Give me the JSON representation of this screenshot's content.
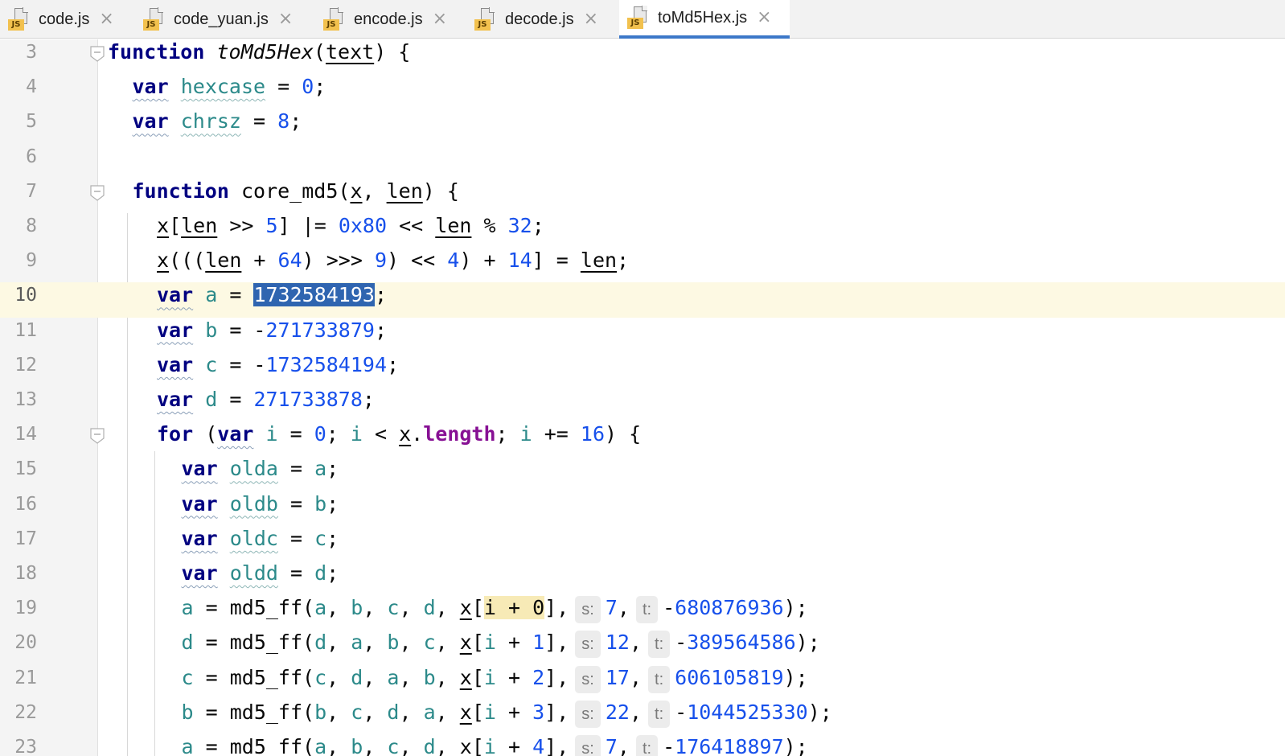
{
  "tabs": [
    {
      "label": "code.js",
      "active": false,
      "icon": "js-file-icon"
    },
    {
      "label": "code_yuan.js",
      "active": false,
      "icon": "js-file-icon"
    },
    {
      "label": "encode.js",
      "active": false,
      "icon": "js-file-icon"
    },
    {
      "label": "decode.js",
      "active": false,
      "icon": "js-file-icon"
    },
    {
      "label": "toMd5Hex.js",
      "active": true,
      "icon": "js-file-icon"
    }
  ],
  "js_badge": "JS",
  "close_glyph": "×",
  "editor": {
    "current_line": "10",
    "lines": [
      {
        "n": "3",
        "tokens": [
          [
            "kw",
            "function"
          ],
          [
            "t",
            " "
          ],
          [
            "fi",
            "toMd5Hex"
          ],
          [
            "t",
            "("
          ],
          [
            "p",
            "text"
          ],
          [
            "t",
            ") {"
          ]
        ]
      },
      {
        "n": "4",
        "tokens": [
          [
            "kww",
            "var"
          ],
          [
            "t",
            " "
          ],
          [
            "vw",
            "hexcase"
          ],
          [
            "t",
            " = "
          ],
          [
            "num",
            "0"
          ],
          [
            "t",
            ";"
          ]
        ]
      },
      {
        "n": "5",
        "tokens": [
          [
            "kww",
            "var"
          ],
          [
            "t",
            " "
          ],
          [
            "vw",
            "chrsz"
          ],
          [
            "t",
            " = "
          ],
          [
            "num",
            "8"
          ],
          [
            "t",
            ";"
          ]
        ]
      },
      {
        "n": "6",
        "tokens": []
      },
      {
        "n": "7",
        "tokens": [
          [
            "kw",
            "function"
          ],
          [
            "t",
            " core_md5("
          ],
          [
            "p",
            "x"
          ],
          [
            "t",
            ", "
          ],
          [
            "p",
            "len"
          ],
          [
            "t",
            ") {"
          ]
        ]
      },
      {
        "n": "8",
        "tokens": [
          [
            "p",
            "x"
          ],
          [
            "t",
            "["
          ],
          [
            "p",
            "len"
          ],
          [
            "t",
            " >> "
          ],
          [
            "num",
            "5"
          ],
          [
            "t",
            "] |= "
          ],
          [
            "num",
            "0x80"
          ],
          [
            "t",
            " << "
          ],
          [
            "p",
            "len"
          ],
          [
            "t",
            " % "
          ],
          [
            "num",
            "32"
          ],
          [
            "t",
            ";"
          ]
        ]
      },
      {
        "n": "9",
        "tokens": [
          [
            "p",
            "x"
          ],
          [
            "t",
            "((("
          ],
          [
            "p",
            "len"
          ],
          [
            "t",
            " + "
          ],
          [
            "num",
            "64"
          ],
          [
            "t",
            ") >>> "
          ],
          [
            "num",
            "9"
          ],
          [
            "t",
            ") << "
          ],
          [
            "num",
            "4"
          ],
          [
            "t",
            ") + "
          ],
          [
            "num",
            "14"
          ],
          [
            "t",
            "] = "
          ],
          [
            "p",
            "len"
          ],
          [
            "t",
            ";"
          ]
        ]
      },
      {
        "n": "10",
        "tokens": [
          [
            "kww",
            "var"
          ],
          [
            "t",
            " "
          ],
          [
            "v",
            "a"
          ],
          [
            "t",
            " = "
          ],
          [
            "sel",
            "1732584193"
          ],
          [
            "t",
            ";"
          ]
        ]
      },
      {
        "n": "11",
        "tokens": [
          [
            "kww",
            "var"
          ],
          [
            "t",
            " "
          ],
          [
            "v",
            "b"
          ],
          [
            "t",
            " = -"
          ],
          [
            "num",
            "271733879"
          ],
          [
            "t",
            ";"
          ]
        ]
      },
      {
        "n": "12",
        "tokens": [
          [
            "kww",
            "var"
          ],
          [
            "t",
            " "
          ],
          [
            "v",
            "c"
          ],
          [
            "t",
            " = -"
          ],
          [
            "num",
            "1732584194"
          ],
          [
            "t",
            ";"
          ]
        ]
      },
      {
        "n": "13",
        "tokens": [
          [
            "kww",
            "var"
          ],
          [
            "t",
            " "
          ],
          [
            "v",
            "d"
          ],
          [
            "t",
            " = "
          ],
          [
            "num",
            "271733878"
          ],
          [
            "t",
            ";"
          ]
        ]
      },
      {
        "n": "14",
        "tokens": [
          [
            "kw",
            "for"
          ],
          [
            "t",
            " ("
          ],
          [
            "kww",
            "var"
          ],
          [
            "t",
            " "
          ],
          [
            "v",
            "i"
          ],
          [
            "t",
            " = "
          ],
          [
            "num",
            "0"
          ],
          [
            "t",
            "; "
          ],
          [
            "v",
            "i"
          ],
          [
            "t",
            " < "
          ],
          [
            "p",
            "x"
          ],
          [
            "t",
            "."
          ],
          [
            "prop",
            "length"
          ],
          [
            "t",
            "; "
          ],
          [
            "v",
            "i"
          ],
          [
            "t",
            " += "
          ],
          [
            "num",
            "16"
          ],
          [
            "t",
            ") {"
          ]
        ]
      },
      {
        "n": "15",
        "tokens": [
          [
            "kww",
            "var"
          ],
          [
            "t",
            " "
          ],
          [
            "vw",
            "olda"
          ],
          [
            "t",
            " = "
          ],
          [
            "v",
            "a"
          ],
          [
            "t",
            ";"
          ]
        ]
      },
      {
        "n": "16",
        "tokens": [
          [
            "kww",
            "var"
          ],
          [
            "t",
            " "
          ],
          [
            "vw",
            "oldb"
          ],
          [
            "t",
            " = "
          ],
          [
            "v",
            "b"
          ],
          [
            "t",
            ";"
          ]
        ]
      },
      {
        "n": "17",
        "tokens": [
          [
            "kww",
            "var"
          ],
          [
            "t",
            " "
          ],
          [
            "vw",
            "oldc"
          ],
          [
            "t",
            " = "
          ],
          [
            "v",
            "c"
          ],
          [
            "t",
            ";"
          ]
        ]
      },
      {
        "n": "18",
        "tokens": [
          [
            "kww",
            "var"
          ],
          [
            "t",
            " "
          ],
          [
            "vw",
            "oldd"
          ],
          [
            "t",
            " = "
          ],
          [
            "v",
            "d"
          ],
          [
            "t",
            ";"
          ]
        ]
      },
      {
        "n": "19",
        "tokens": [
          [
            "v",
            "a"
          ],
          [
            "t",
            " = md5_ff("
          ],
          [
            "v",
            "a"
          ],
          [
            "t",
            ", "
          ],
          [
            "v",
            "b"
          ],
          [
            "t",
            ", "
          ],
          [
            "v",
            "c"
          ],
          [
            "t",
            ", "
          ],
          [
            "v",
            "d"
          ],
          [
            "t",
            ", "
          ],
          [
            "p",
            "x"
          ],
          [
            "t",
            "["
          ],
          [
            "hl",
            "i + 0"
          ],
          [
            "t",
            "],"
          ],
          [
            "hint",
            "s:"
          ],
          [
            "num",
            "7"
          ],
          [
            "t",
            ","
          ],
          [
            "hint",
            "t:"
          ],
          [
            "t",
            "-"
          ],
          [
            "num",
            "680876936"
          ],
          [
            "t",
            ");"
          ]
        ]
      },
      {
        "n": "20",
        "tokens": [
          [
            "v",
            "d"
          ],
          [
            "t",
            " = md5_ff("
          ],
          [
            "v",
            "d"
          ],
          [
            "t",
            ", "
          ],
          [
            "v",
            "a"
          ],
          [
            "t",
            ", "
          ],
          [
            "v",
            "b"
          ],
          [
            "t",
            ", "
          ],
          [
            "v",
            "c"
          ],
          [
            "t",
            ", "
          ],
          [
            "p",
            "x"
          ],
          [
            "t",
            "["
          ],
          [
            "v",
            "i"
          ],
          [
            "t",
            " + "
          ],
          [
            "num",
            "1"
          ],
          [
            "t",
            "],"
          ],
          [
            "hint",
            "s:"
          ],
          [
            "num",
            "12"
          ],
          [
            "t",
            ","
          ],
          [
            "hint",
            "t:"
          ],
          [
            "t",
            "-"
          ],
          [
            "num",
            "389564586"
          ],
          [
            "t",
            ");"
          ]
        ]
      },
      {
        "n": "21",
        "tokens": [
          [
            "v",
            "c"
          ],
          [
            "t",
            " = md5_ff("
          ],
          [
            "v",
            "c"
          ],
          [
            "t",
            ", "
          ],
          [
            "v",
            "d"
          ],
          [
            "t",
            ", "
          ],
          [
            "v",
            "a"
          ],
          [
            "t",
            ", "
          ],
          [
            "v",
            "b"
          ],
          [
            "t",
            ", "
          ],
          [
            "p",
            "x"
          ],
          [
            "t",
            "["
          ],
          [
            "v",
            "i"
          ],
          [
            "t",
            " + "
          ],
          [
            "num",
            "2"
          ],
          [
            "t",
            "],"
          ],
          [
            "hint",
            "s:"
          ],
          [
            "num",
            "17"
          ],
          [
            "t",
            ","
          ],
          [
            "hint",
            "t:"
          ],
          [
            "num",
            "606105819"
          ],
          [
            "t",
            ");"
          ]
        ]
      },
      {
        "n": "22",
        "tokens": [
          [
            "v",
            "b"
          ],
          [
            "t",
            " = md5_ff("
          ],
          [
            "v",
            "b"
          ],
          [
            "t",
            ", "
          ],
          [
            "v",
            "c"
          ],
          [
            "t",
            ", "
          ],
          [
            "v",
            "d"
          ],
          [
            "t",
            ", "
          ],
          [
            "v",
            "a"
          ],
          [
            "t",
            ", "
          ],
          [
            "p",
            "x"
          ],
          [
            "t",
            "["
          ],
          [
            "v",
            "i"
          ],
          [
            "t",
            " + "
          ],
          [
            "num",
            "3"
          ],
          [
            "t",
            "],"
          ],
          [
            "hint",
            "s:"
          ],
          [
            "num",
            "22"
          ],
          [
            "t",
            ","
          ],
          [
            "hint",
            "t:"
          ],
          [
            "t",
            "-"
          ],
          [
            "num",
            "1044525330"
          ],
          [
            "t",
            ");"
          ]
        ]
      },
      {
        "n": "23",
        "tokens": [
          [
            "v",
            "a"
          ],
          [
            "t",
            " = md5_ff("
          ],
          [
            "v",
            "a"
          ],
          [
            "t",
            ", "
          ],
          [
            "v",
            "b"
          ],
          [
            "t",
            ", "
          ],
          [
            "v",
            "c"
          ],
          [
            "t",
            ", "
          ],
          [
            "v",
            "d"
          ],
          [
            "t",
            ", "
          ],
          [
            "p",
            "x"
          ],
          [
            "t",
            "["
          ],
          [
            "v",
            "i"
          ],
          [
            "t",
            " + "
          ],
          [
            "num",
            "4"
          ],
          [
            "t",
            "],"
          ],
          [
            "hint",
            "s:"
          ],
          [
            "num",
            "7"
          ],
          [
            "t",
            ","
          ],
          [
            "hint",
            "t:"
          ],
          [
            "t",
            "-"
          ],
          [
            "num",
            "176418897"
          ],
          [
            "t",
            ");"
          ]
        ]
      }
    ]
  }
}
